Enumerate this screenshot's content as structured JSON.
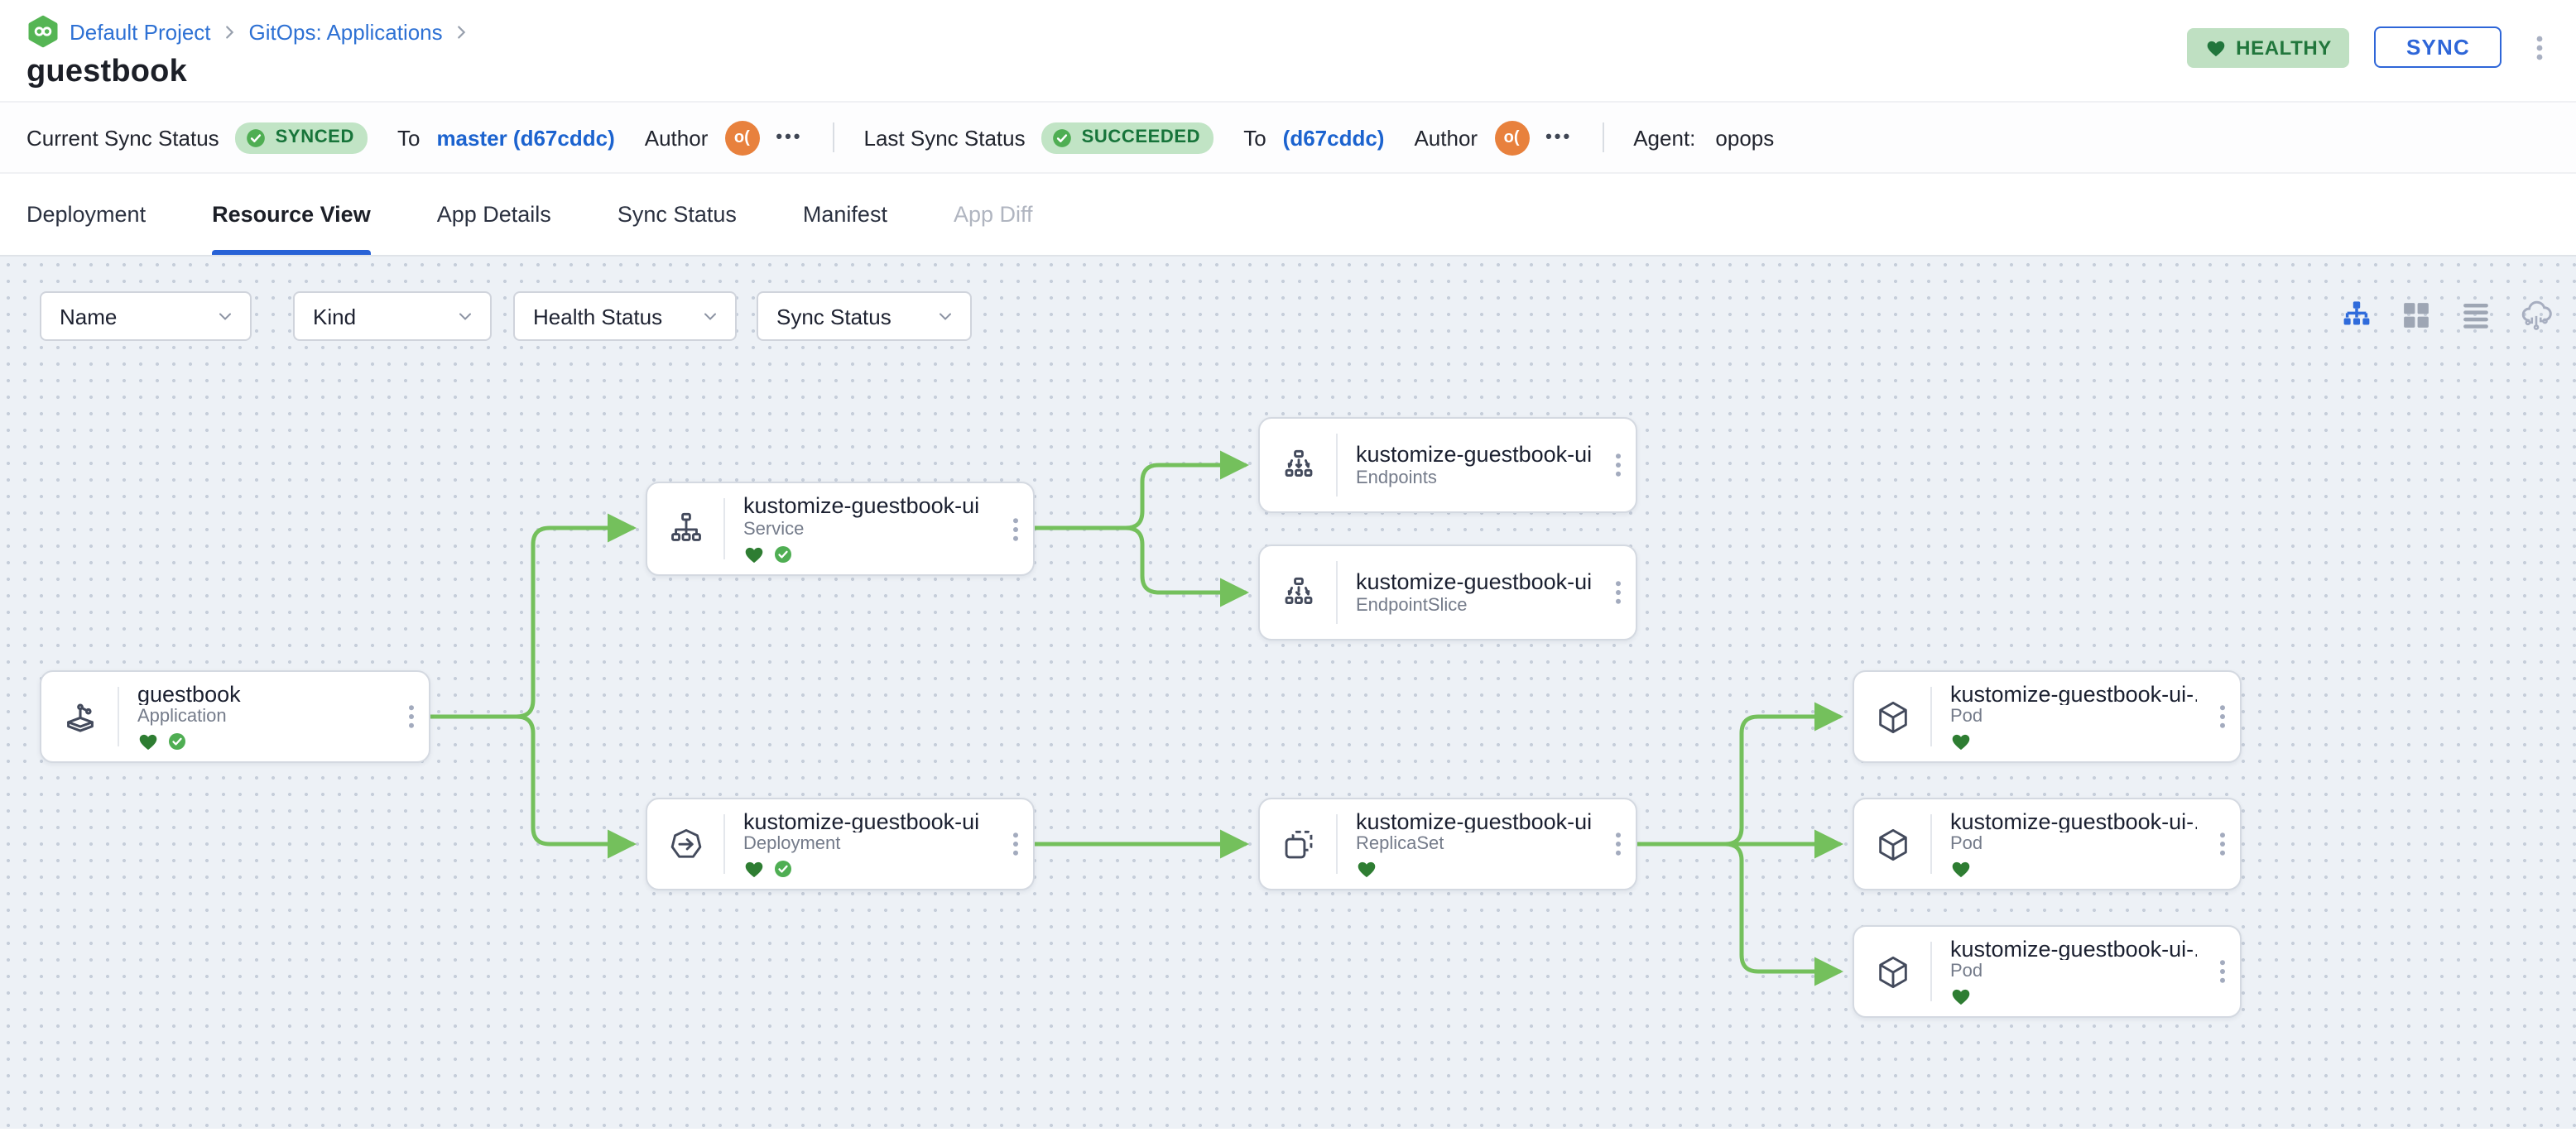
{
  "header": {
    "breadcrumb": {
      "items": [
        "Default Project",
        "GitOps: Applications"
      ]
    },
    "title": "guestbook",
    "health_badge": "HEALTHY",
    "sync_button": "SYNC"
  },
  "status_bar": {
    "current": {
      "label": "Current Sync Status",
      "badge": "SYNCED",
      "to_label": "To",
      "target": "master (d67cddc)",
      "author_label": "Author",
      "avatar_initials": "o(",
      "more": "•••"
    },
    "last": {
      "label": "Last Sync Status",
      "badge": "SUCCEEDED",
      "to_label": "To",
      "target": "(d67cddc)",
      "author_label": "Author",
      "avatar_initials": "o(",
      "more": "•••"
    },
    "agent": {
      "label": "Agent:",
      "value": "opops"
    }
  },
  "tabs": [
    {
      "label": "Deployment",
      "state": "normal"
    },
    {
      "label": "Resource View",
      "state": "active"
    },
    {
      "label": "App Details",
      "state": "normal"
    },
    {
      "label": "Sync Status",
      "state": "normal"
    },
    {
      "label": "Manifest",
      "state": "normal"
    },
    {
      "label": "App Diff",
      "state": "disabled"
    }
  ],
  "filters": [
    {
      "label": "Name"
    },
    {
      "label": "Kind"
    },
    {
      "label": "Health Status"
    },
    {
      "label": "Sync Status"
    }
  ],
  "view_toggles": [
    "tree-view",
    "grid-view",
    "list-view",
    "cloud-view"
  ],
  "graph": {
    "nodes": [
      {
        "title": "guestbook",
        "kind": "Application",
        "healthy": true,
        "synced": true
      },
      {
        "title": "kustomize-guestbook-ui",
        "kind": "Service",
        "healthy": true,
        "synced": true
      },
      {
        "title": "kustomize-guestbook-ui",
        "kind": "Endpoints",
        "healthy": false,
        "synced": false
      },
      {
        "title": "kustomize-guestbook-ui-...",
        "kind": "EndpointSlice",
        "healthy": false,
        "synced": false
      },
      {
        "title": "kustomize-guestbook-ui",
        "kind": "Deployment",
        "healthy": true,
        "synced": true
      },
      {
        "title": "kustomize-guestbook-ui-...",
        "kind": "ReplicaSet",
        "healthy": true,
        "synced": false
      },
      {
        "title": "kustomize-guestbook-ui-...",
        "kind": "Pod",
        "healthy": true,
        "synced": false
      },
      {
        "title": "kustomize-guestbook-ui-...",
        "kind": "Pod",
        "healthy": true,
        "synced": false
      },
      {
        "title": "kustomize-guestbook-ui-...",
        "kind": "Pod",
        "healthy": true,
        "synced": false
      }
    ],
    "edges": [
      "guestbook->service",
      "guestbook->deployment",
      "service->endpoints",
      "service->endpointslice",
      "deployment->replicaset",
      "replicaset->pod-1",
      "replicaset->pod-2",
      "replicaset->pod-3"
    ]
  },
  "icons": {
    "logo": "devtron-infinity-hexagon",
    "application": "crane-box",
    "service": "service-tree",
    "endpoints": "fan-out-arrows",
    "endpointslice": "fan-out-arrows-dashed",
    "deployment": "heptagon-arrow",
    "replicaset": "stacked-squares",
    "pod": "cube",
    "healthy": "heart",
    "synced": "check-circle"
  },
  "colors": {
    "accent_blue": "#2e66d8",
    "link_blue": "#2e71d4",
    "commit_blue": "#1c63cf",
    "badge_green_bg": "#c1e4c5",
    "badge_green_text": "#17743a",
    "health_pill_bg": "#bfe0c2",
    "heart_green": "#2e7d32",
    "check_green": "#4fae53",
    "edge_green": "#74c05c",
    "canvas_bg": "#edf1f6",
    "avatar_orange": "#e8813d"
  }
}
